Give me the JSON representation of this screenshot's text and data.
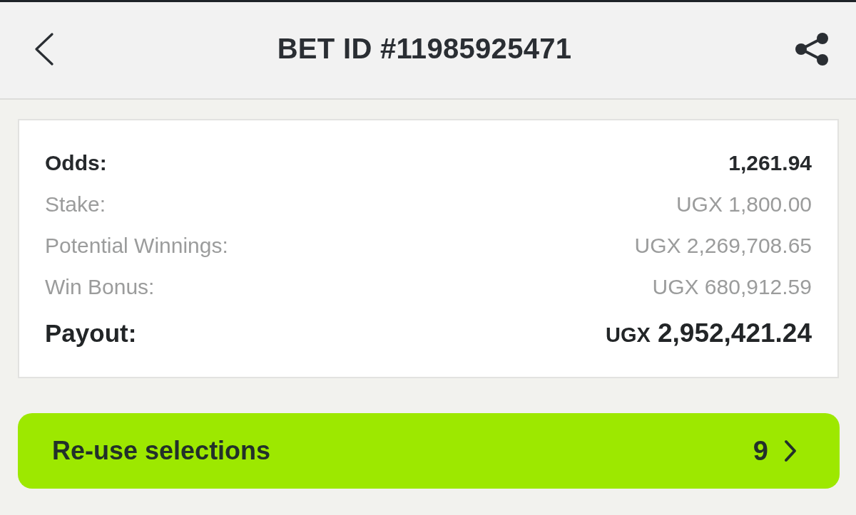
{
  "header": {
    "title": "BET ID #11985925471"
  },
  "summary": {
    "rows": [
      {
        "kind": "strong",
        "label": "Odds:",
        "value": "1,261.94"
      },
      {
        "kind": "muted",
        "label": "Stake:",
        "value": "UGX 1,800.00"
      },
      {
        "kind": "muted",
        "label": "Potential Winnings:",
        "value": "UGX 2,269,708.65"
      },
      {
        "kind": "muted",
        "label": "Win Bonus:",
        "value": "UGX 680,912.59"
      },
      {
        "kind": "total",
        "label": "Payout:",
        "currency": "UGX",
        "value": "2,952,421.24"
      }
    ]
  },
  "reuse_button": {
    "label": "Re-use selections",
    "count": "9"
  }
}
